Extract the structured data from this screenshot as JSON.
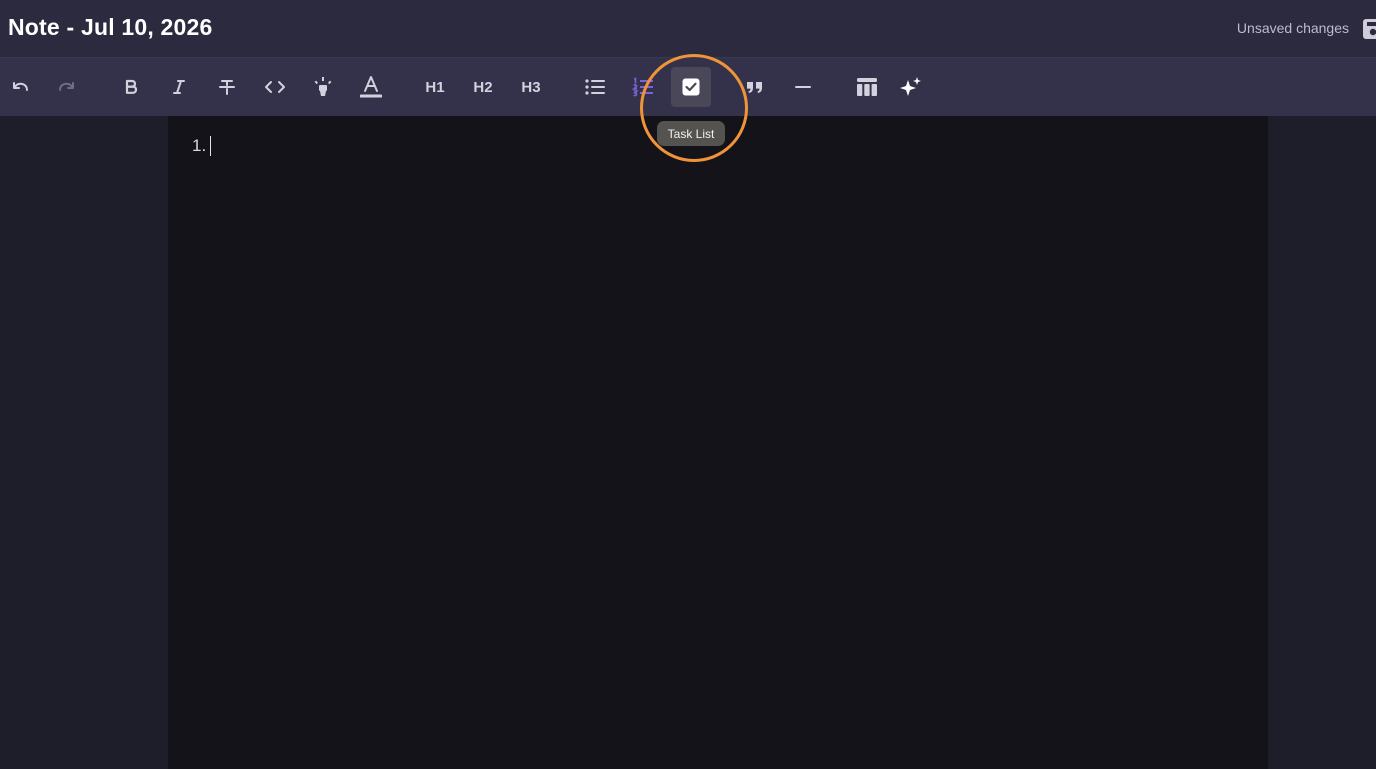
{
  "header": {
    "title": "Note - Jul 10, 2026",
    "status": "Unsaved changes",
    "save_icon": "save-icon"
  },
  "toolbar": {
    "buttons": [
      {
        "name": "undo",
        "icon": "undo-icon",
        "state": "enabled"
      },
      {
        "name": "redo",
        "icon": "redo-icon",
        "state": "disabled"
      },
      {
        "name": "bold",
        "icon": "bold-icon"
      },
      {
        "name": "italic",
        "icon": "italic-icon"
      },
      {
        "name": "strikethrough",
        "icon": "strikethrough-icon"
      },
      {
        "name": "code",
        "icon": "code-icon"
      },
      {
        "name": "highlight",
        "icon": "highlighter-icon"
      },
      {
        "name": "text-color",
        "icon": "text-color-icon"
      },
      {
        "name": "heading-1",
        "label": "H1"
      },
      {
        "name": "heading-2",
        "label": "H2"
      },
      {
        "name": "heading-3",
        "label": "H3"
      },
      {
        "name": "bullet-list",
        "icon": "bullet-list-icon"
      },
      {
        "name": "ordered-list",
        "icon": "ordered-list-icon",
        "state": "active"
      },
      {
        "name": "task-list",
        "icon": "checkbox-icon",
        "state": "hovered"
      },
      {
        "name": "blockquote",
        "icon": "quote-icon"
      },
      {
        "name": "horizontal-rule",
        "icon": "horizontal-rule-icon"
      },
      {
        "name": "table",
        "icon": "table-icon"
      },
      {
        "name": "ai-assist",
        "icon": "sparkles-icon"
      }
    ],
    "tooltip": "Task List"
  },
  "editor": {
    "list_marker": "1."
  },
  "colors": {
    "header_bg": "#2c2a3e",
    "toolbar_bg": "#34324a",
    "editor_bg": "#141319",
    "accent": "#7b62d9",
    "highlight_ring": "#f0943a"
  }
}
